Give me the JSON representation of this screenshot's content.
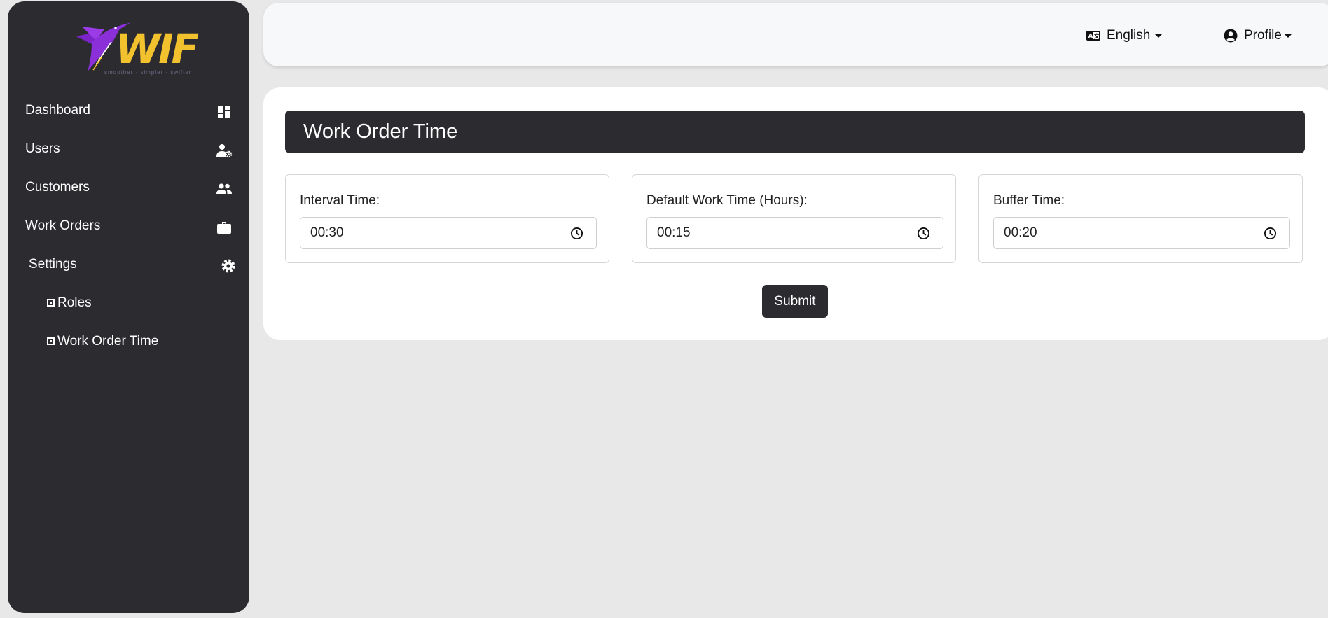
{
  "sidebar": {
    "logo": {
      "word": "WIF",
      "tagline": "smoother · simpler · swifter",
      "colors": {
        "bird": "#8b2fd9",
        "text": "#f2c12e"
      }
    },
    "items": [
      {
        "label": "Dashboard",
        "icon": "dashboard-icon"
      },
      {
        "label": "Users",
        "icon": "user-gear-icon"
      },
      {
        "label": "Customers",
        "icon": "users-icon"
      },
      {
        "label": "Work Orders",
        "icon": "briefcase-icon"
      },
      {
        "label": "Settings",
        "icon": "gear-icon"
      }
    ],
    "subitems": [
      {
        "label": "Roles",
        "icon": "square-bullet-icon"
      },
      {
        "label": "Work Order Time",
        "icon": "square-bullet-icon"
      }
    ]
  },
  "topbar": {
    "language": {
      "label": "English",
      "icon": "translate-icon"
    },
    "profile": {
      "label": "Profile",
      "icon": "user-circle-icon"
    }
  },
  "main": {
    "title": "Work Order Time",
    "fields": [
      {
        "label": "Interval Time:",
        "value": "00:30",
        "icon": "clock-icon"
      },
      {
        "label": "Default Work Time (Hours):",
        "value": "00:15",
        "icon": "clock-icon"
      },
      {
        "label": "Buffer Time:",
        "value": "00:20",
        "icon": "clock-icon"
      }
    ],
    "submit_label": "Submit"
  },
  "colors": {
    "sidebar_bg": "#2c2b30",
    "page_bg": "#e8e8e8",
    "accent_dark": "#2c2b30"
  }
}
